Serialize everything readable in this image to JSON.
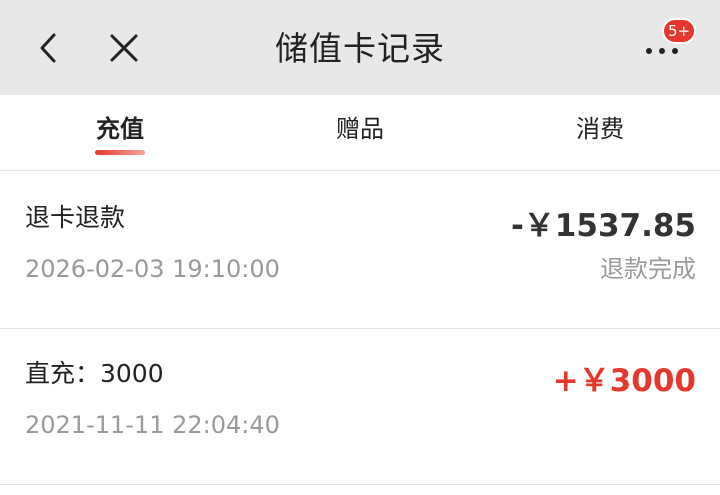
{
  "header": {
    "title": "储值卡记录",
    "badge": "5+",
    "back_icon": "chevron-left-icon",
    "close_icon": "close-icon",
    "more_icon": "more-dots-icon"
  },
  "tabs": [
    {
      "label": "充值",
      "active": true
    },
    {
      "label": "赠品",
      "active": false
    },
    {
      "label": "消费",
      "active": false
    }
  ],
  "records": [
    {
      "title": "退卡退款",
      "time": "2026-02-03 19:10:00",
      "amount": "-￥1537.85",
      "status": "退款完成",
      "amount_color": "#333333"
    },
    {
      "title": "直充：3000",
      "time": "2021-11-11 22:04:40",
      "amount": "+￥3000",
      "amount_color": "#e5382b"
    }
  ],
  "colors": {
    "accent": "#e5382b",
    "header_bg": "#e8e8e8",
    "muted_text": "#999999"
  }
}
